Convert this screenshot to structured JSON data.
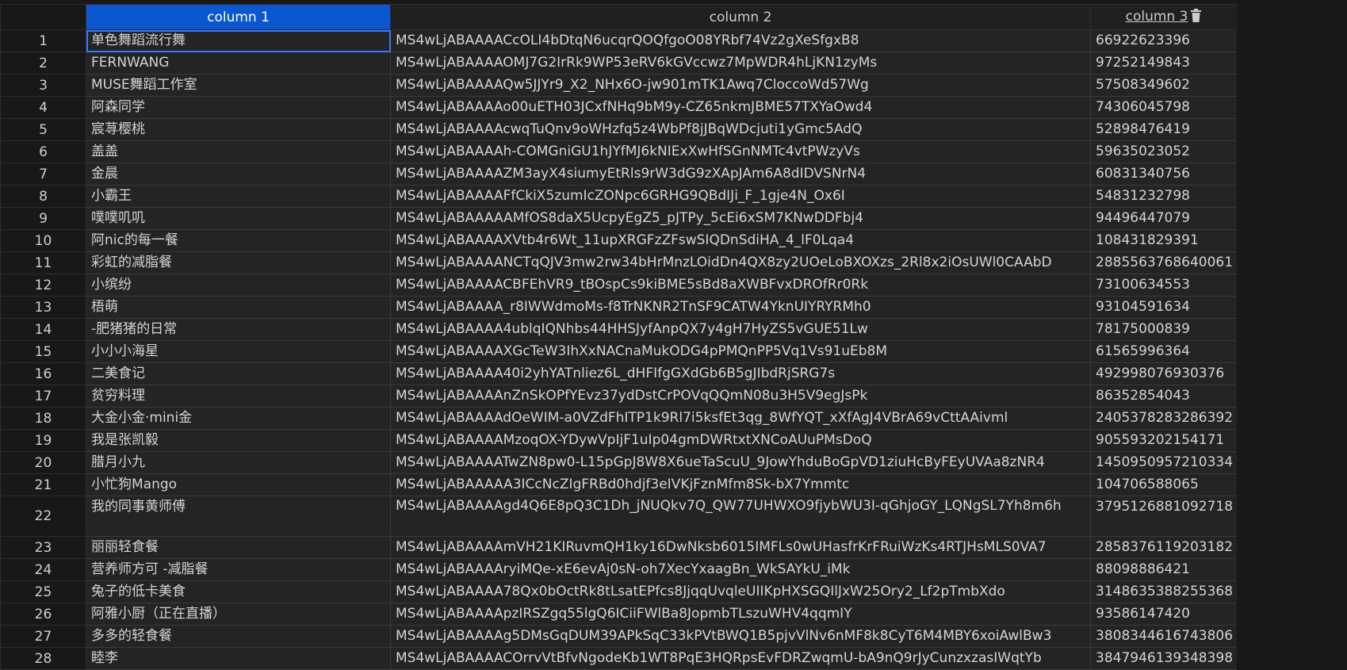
{
  "table": {
    "columns": [
      "column 1",
      "column 2",
      "column 3"
    ],
    "delete_icon": "trash-icon",
    "accent_color": "#0b57d0",
    "rows": [
      {
        "n": "1",
        "c1": "单色舞蹈流行舞",
        "c2": "MS4wLjABAAAACcOLI4bDtqN6ucqrQOQfgoO08YRbf74Vz2gXeSfgxB8",
        "c3": "66922623396"
      },
      {
        "n": "2",
        "c1": "FERNWANG",
        "c2": "MS4wLjABAAAAOMJ7G2IrRk9WP53eRV6kGVccwz7MpWDR4hLjKN1zyMs",
        "c3": "97252149843"
      },
      {
        "n": "3",
        "c1": "MUSE舞蹈工作室",
        "c2": "MS4wLjABAAAAQw5JJYr9_X2_NHx6O-jw901mTK1Awq7CloccoWd57Wg",
        "c3": "57508349602"
      },
      {
        "n": "4",
        "c1": "阿森同学",
        "c2": "MS4wLjABAAAAo00uETH03JCxfNHq9bM9y-CZ65nkmJBME57TXYaOwd4",
        "c3": "74306045798"
      },
      {
        "n": "5",
        "c1": "宸荨樱桃",
        "c2": "MS4wLjABAAAAcwqTuQnv9oWHzfq5z4WbPf8jJBqWDcjuti1yGmc5AdQ",
        "c3": "52898476419"
      },
      {
        "n": "6",
        "c1": "盖盖",
        "c2": "MS4wLjABAAAAh-COMGniGU1hJYfMJ6kNIExXwHfSGnNMTc4vtPWzyVs",
        "c3": "59635023052"
      },
      {
        "n": "7",
        "c1": "金晨",
        "c2": "MS4wLjABAAAAZM3ayX4siumyEtRls9rW3dG9zXApJAm6A8dIDVSNrN4",
        "c3": "60831340756"
      },
      {
        "n": "8",
        "c1": "小霸王",
        "c2": "MS4wLjABAAAAFfCkiX5zumIcZONpc6GRHG9QBdIJi_F_1gje4N_Ox6I",
        "c3": "54831232798"
      },
      {
        "n": "9",
        "c1": "噗噗叽叽",
        "c2": "MS4wLjABAAAAAMfOS8daX5UcpyEgZ5_pJTPy_5cEi6xSM7KNwDDFbj4",
        "c3": "94496447079"
      },
      {
        "n": "10",
        "c1": "阿nic的每一餐",
        "c2": "MS4wLjABAAAAXVtb4r6Wt_11upXRGFzZFswSIQDnSdiHA_4_lF0Lqa4",
        "c3": "108431829391"
      },
      {
        "n": "11",
        "c1": "彩虹的减脂餐",
        "c2": "MS4wLjABAAAANCTqQJV3mw2rw34bHrMnzLOidDn4QX8zy2UOeLoBXOXzs_2Rl8x2iOsUWl0CAAbD",
        "c3": "2885563768640061"
      },
      {
        "n": "12",
        "c1": "小缤纷",
        "c2": "MS4wLjABAAAACBFEhVR9_tBOspCs9kiBME5sBd8aXWBFvxDROfRr0Rk",
        "c3": "73100634553"
      },
      {
        "n": "13",
        "c1": "梧萌",
        "c2": "MS4wLjABAAAA_r8IWWdmoMs-f8TrNKNR2TnSF9CATW4YknUIYRYRMh0",
        "c3": "93104591634"
      },
      {
        "n": "14",
        "c1": "-肥猪猪的日常",
        "c2": "MS4wLjABAAAA4ublqIQNhbs44HHSJyfAnpQX7y4gH7HyZS5vGUE51Lw",
        "c3": "78175000839"
      },
      {
        "n": "15",
        "c1": "小小小海星",
        "c2": "MS4wLjABAAAAXGcTeW3IhXxNACnaMukODG4pPMQnPP5Vq1Vs91uEb8M",
        "c3": "61565996364"
      },
      {
        "n": "16",
        "c1": "二美食记",
        "c2": "MS4wLjABAAAA40i2yhYATnliez6L_dHFIfgGXdGb6B5gJIbdRjSRG7s",
        "c3": "492998076930376"
      },
      {
        "n": "17",
        "c1": "贫穷料理",
        "c2": "MS4wLjABAAAAnZnSkOPfYEvz37ydDstCrPOVqQQmN08u3H5V9egJsPk",
        "c3": "86352854043"
      },
      {
        "n": "18",
        "c1": "大金小金·mini金",
        "c2": "MS4wLjABAAAAdOeWIM-a0VZdFhITP1k9Rl7i5ksfEt3qg_8WfYQT_xXfAgJ4VBrA69vCttAAivml",
        "c3": "2405378283286392"
      },
      {
        "n": "19",
        "c1": "我是张凯毅",
        "c2": "MS4wLjABAAAAMzoqOX-YDywVpIjF1uIp04gmDWRtxtXNCoAUuPMsDoQ",
        "c3": "905593202154171"
      },
      {
        "n": "20",
        "c1": "腊月小九",
        "c2": "MS4wLjABAAAATwZN8pw0-L15pGpJ8W8X6ueTaScuU_9JowYhduBoGpVD1ziuHcByFEyUVAa8zNR4",
        "c3": "1450950957210334"
      },
      {
        "n": "21",
        "c1": "小忙狗Mango",
        "c2": "MS4wLjABAAAAA3ICcNcZIgFRBd0hdjf3eIVKjFznMfm8Sk-bX7Ymmtc",
        "c3": "104706588065"
      },
      {
        "n": "22",
        "c1": "我的同事黄师傅",
        "c2": "MS4wLjABAAAAgd4Q6E8pQ3C1Dh_jNUQkv7Q_QW77UHWXO9fjybWU3I-qGhjoGY_LQNgSL7Yh8m6h",
        "c3": "3795126881092718",
        "tall": true
      },
      {
        "n": "23",
        "c1": "丽丽轻食餐",
        "c2": "MS4wLjABAAAAmVH21KIRuvmQH1ky16DwNksb6015IMFLs0wUHasfrKrFRuiWzKs4RTJHsMLS0VA7",
        "c3": "2858376119203182"
      },
      {
        "n": "24",
        "c1": "营养师方可 -减脂餐",
        "c2": "MS4wLjABAAAAryiMQe-xE6evAj0sN-oh7XecYxaagBn_WkSAYkU_iMk",
        "c3": "88098886421"
      },
      {
        "n": "25",
        "c1": "兔子的低卡美食",
        "c2": "MS4wLjABAAAA78Qx0bOctRk8tLsatEPfcs8JjqqUvqleUIIKpHXSGQIlJxW25Ory2_Lf2pTmbXdo",
        "c3": "3148635388255368"
      },
      {
        "n": "26",
        "c1": "阿雅小厨（正在直播）",
        "c2": "MS4wLjABAAAApzIRSZgq55lgQ6ICiiFWlBa8JopmbTLszuWHV4qqmIY",
        "c3": "93586147420"
      },
      {
        "n": "27",
        "c1": "多多的轻食餐",
        "c2": "MS4wLjABAAAAg5DMsGqDUM39APkSqC33kPVtBWQ1B5pjvVlNv6nMF8k8CyT6M4MBY6xoiAwlBw3",
        "c3": "3808344616743806"
      },
      {
        "n": "28",
        "c1": "睦李",
        "c2": "MS4wLjABAAAACOrrvVtBfvNgodeKb1WT8PqE3HQRpsEvFDRZwqmU-bA9nQ9rJyCunzxzasIWqtYb",
        "c3": "3847946139348398"
      }
    ]
  }
}
